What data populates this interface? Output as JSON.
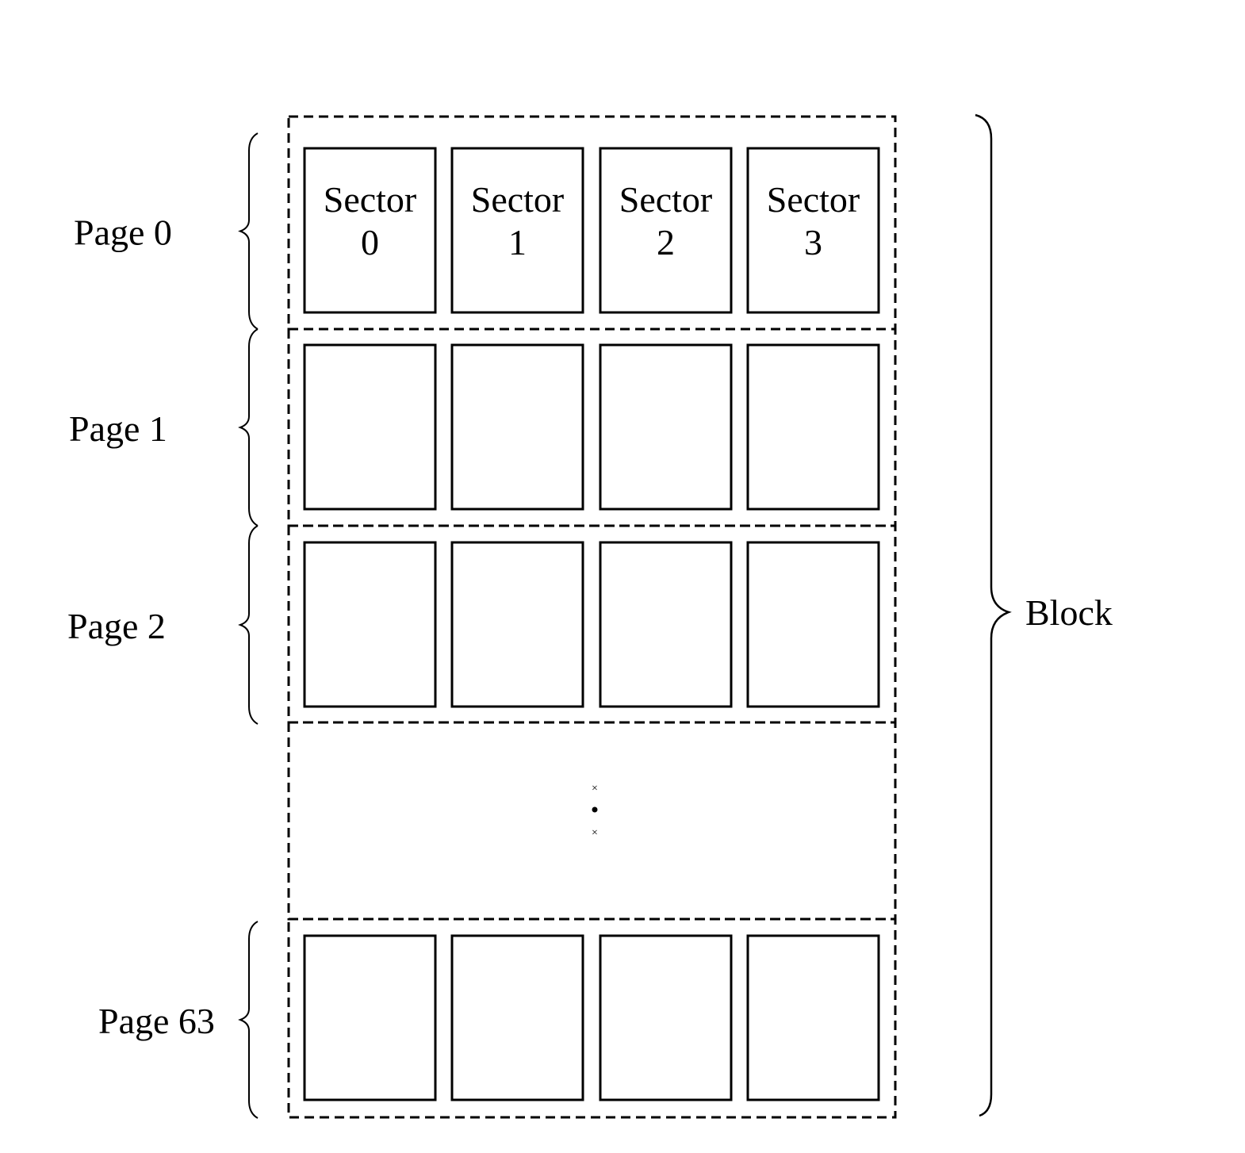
{
  "diagram": {
    "block_label": "Block",
    "ellipsis": "⋮",
    "pages": [
      {
        "label": "Page 0",
        "sectors": [
          {
            "line1": "Sector",
            "line2": "0"
          },
          {
            "line1": "Sector",
            "line2": "1"
          },
          {
            "line1": "Sector",
            "line2": "2"
          },
          {
            "line1": "Sector",
            "line2": "3"
          }
        ]
      },
      {
        "label": "Page 1",
        "sectors": [
          {},
          {},
          {},
          {}
        ]
      },
      {
        "label": "Page 2",
        "sectors": [
          {},
          {},
          {},
          {}
        ]
      },
      {
        "label": "Page 63",
        "sectors": [
          {},
          {},
          {},
          {}
        ]
      }
    ],
    "colors": {
      "stroke": "#000000",
      "background": "#ffffff"
    }
  }
}
